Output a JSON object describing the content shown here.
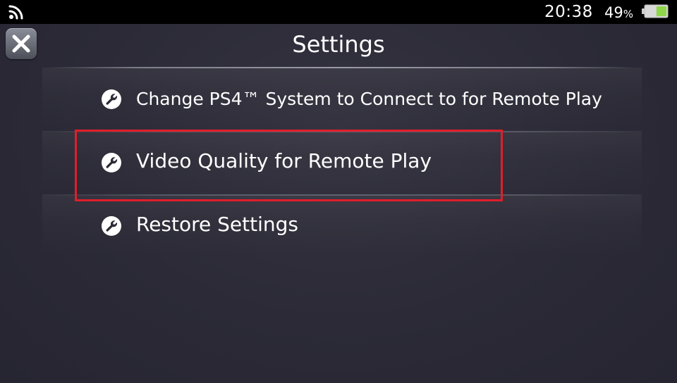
{
  "status_bar": {
    "time": "20:38",
    "battery_percent": "49",
    "battery_unit": "%",
    "battery_level": 0.49,
    "battery_color": "#8fd64a",
    "wifi_icon": "wifi-icon"
  },
  "header": {
    "title": "Settings",
    "close_icon": "close-icon"
  },
  "menu": {
    "items": [
      {
        "label": "Change PS4™ System to Connect to for Remote Play",
        "icon": "wrench-icon"
      },
      {
        "label": "Video Quality for Remote Play",
        "icon": "wrench-icon"
      },
      {
        "label": "Restore Settings",
        "icon": "wrench-icon"
      }
    ]
  },
  "annotation": {
    "highlight_color": "#e01e2a",
    "highlighted_item_index": 1
  }
}
